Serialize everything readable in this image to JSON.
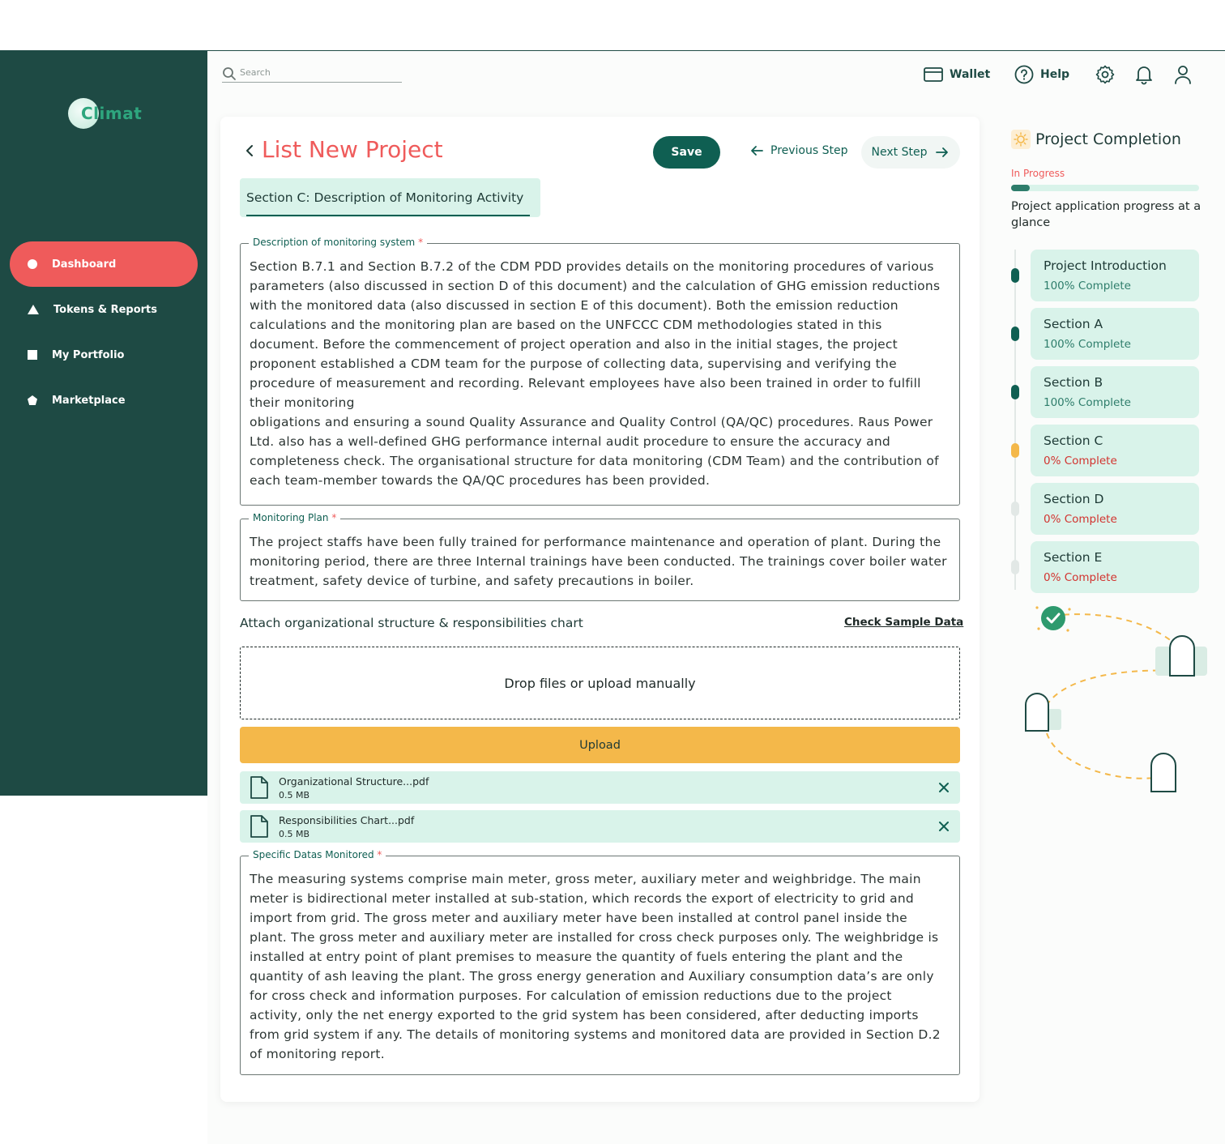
{
  "app": {
    "logo_text": "Climat"
  },
  "search": {
    "placeholder": "Search"
  },
  "topbar": {
    "wallet": "Wallet",
    "help": "Help"
  },
  "sidebar": {
    "items": [
      {
        "label": "Dashboard",
        "icon": "dot-icon",
        "active": true
      },
      {
        "label": "Tokens & Reports",
        "icon": "triangle-icon",
        "active": false
      },
      {
        "label": "My Portfolio",
        "icon": "square-icon",
        "active": false
      },
      {
        "label": "Marketplace",
        "icon": "pentagon-icon",
        "active": false
      }
    ]
  },
  "header": {
    "title": "List New Project",
    "save_label": "Save",
    "prev_label": "Previous Step",
    "next_label": "Next Step"
  },
  "section_tab": {
    "label": "Section C: Description of Monitoring Activity"
  },
  "fields": {
    "monitoring_system": {
      "label": "Description of monitoring system",
      "value": "Section B.7.1 and Section B.7.2 of the CDM PDD provides details on the monitoring procedures of various parameters (also discussed in section D of this document) and the calculation of GHG emission reductions with the monitored data (also discussed in section E of this document). Both the emission reduction calculations and the monitoring plan are based on the UNFCCC CDM methodologies stated in this document. Before the commencement of project operation and also in the initial stages, the project proponent established a CDM team for the purpose of collecting data, supervising and verifying the procedure of measurement and recording. Relevant employees have also been trained in order to fulfill their monitoring",
      "value2": "obligations and ensuring a sound Quality Assurance and Quality Control (QA/QC) procedures. Raus Power Ltd. also has a well-defined GHG performance internal audit procedure to ensure the accuracy and completeness check. The organisational structure for data monitoring (CDM Team) and the contribution of each team-member towards the QA/QC procedures has been provided."
    },
    "monitoring_plan": {
      "label": "Monitoring Plan",
      "value": "The project staffs have been fully trained for performance maintenance and operation of plant. During the monitoring period, there are three Internal trainings have been conducted. The trainings cover boiler water treatment, safety device of turbine, and safety precautions in boiler."
    },
    "specific_data": {
      "label": "Specific Datas Monitored",
      "value": "The measuring systems comprise main meter, gross meter, auxiliary meter and weighbridge. The main meter is bidirectional meter installed at sub-station, which records the export of electricity to grid and import from grid. The gross meter and auxiliary meter have been installed at control panel inside the plant. The gross meter and auxiliary meter are installed for cross check purposes only. The weighbridge is installed at entry point of plant premises to measure the quantity of fuels entering the plant and the quantity of ash leaving the plant. The gross energy generation and Auxiliary consumption data’s are only for cross check and information purposes. For calculation of emission reductions due to the project activity, only the net energy exported to the grid system has been considered, after deducting imports from grid system if any. The details of monitoring systems and monitored data are provided in Section D.2 of monitoring report."
    }
  },
  "attach": {
    "title": "Attach organizational structure & responsibilities chart",
    "check_sample": "Check Sample Data",
    "dropzone_text": "Drop files or upload manually",
    "upload_label": "Upload",
    "files": [
      {
        "name": "Organizational Structure...pdf",
        "size": "0.5 MB"
      },
      {
        "name": "Responsibilities Chart...pdf",
        "size": "0.5 MB"
      }
    ]
  },
  "completion": {
    "title": "Project Completion",
    "status": "In Progress",
    "progress_fraction": 0.1,
    "description": "Project application progress at a glance",
    "steps": [
      {
        "title": "Project Introduction",
        "status": "100% Complete",
        "state": "done"
      },
      {
        "title": "Section A",
        "status": "100% Complete",
        "state": "done"
      },
      {
        "title": "Section B",
        "status": "100% Complete",
        "state": "done"
      },
      {
        "title": "Section C",
        "status": "0% Complete",
        "state": "current"
      },
      {
        "title": "Section D",
        "status": "0% Complete",
        "state": "pending"
      },
      {
        "title": "Section E",
        "status": "0% Complete",
        "state": "pending"
      }
    ]
  },
  "colors": {
    "sidebar": "#1e4a44",
    "accent_red": "#ef5b5b",
    "primary_green": "#0f5f52",
    "upload_yellow": "#f4b84a",
    "mint": "#d9f3ea",
    "done_green": "#2e7d6b",
    "pending_red": "#d2332f"
  }
}
